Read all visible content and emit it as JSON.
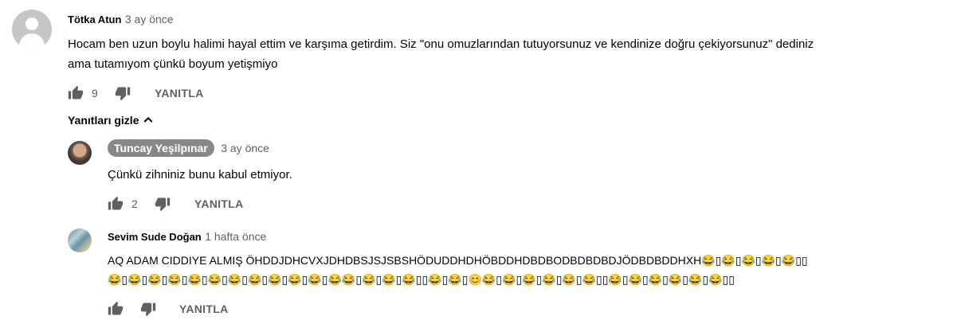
{
  "comment": {
    "author": "Tötka Atun",
    "time": "3 ay önce",
    "text_line1": "Hocam ben uzun boylu halimi hayal ettim ve karşıma getirdim. Siz \"onu omuzlarından tutuyorsunuz ve kendinize doğru çekiyorsunuz\" dediniz",
    "text_line2": "ama tutamıyom çünkü boyum yetişmiyo",
    "likes": "9",
    "reply_label": "YANITLA",
    "toggle_label": "Yanıtları gizle",
    "like_icon": "thumbs-up-icon",
    "dislike_icon": "thumbs-down-icon"
  },
  "replies": [
    {
      "author": "Tuncay Yeşilpınar",
      "time": "3 ay önce",
      "text": "Çünkü zihniniz bunu kabul etmiyor.",
      "likes": "2",
      "reply_label": "YANITLA"
    },
    {
      "author": "Sevim Sude Doğan",
      "time": "1 hafta önce",
      "text_line1": "AQ ADAM CIDDIYE ALMIŞ ÖHDDJDHCVXJDHDBSJSJSBSHÖDUDDHDHÖBDDHDBDBODBDBDBDJÖDBDBDDHXH😂▯😂▯😂▯😂▯😂▯▯",
      "text_line2": "😂▯😂▯😂▯😂▯😂▯😂▯😂▯😂▯😂▯😂▯😂▯😂😂▯😂▯😂▯😂▯▯😂▯😂▯😊😂▯😂▯😂▯😂▯😂▯😂▯▯😂▯😂▯😂▯😂▯😂▯😂▯▯",
      "likes": "",
      "reply_label": "YANITLA"
    }
  ]
}
